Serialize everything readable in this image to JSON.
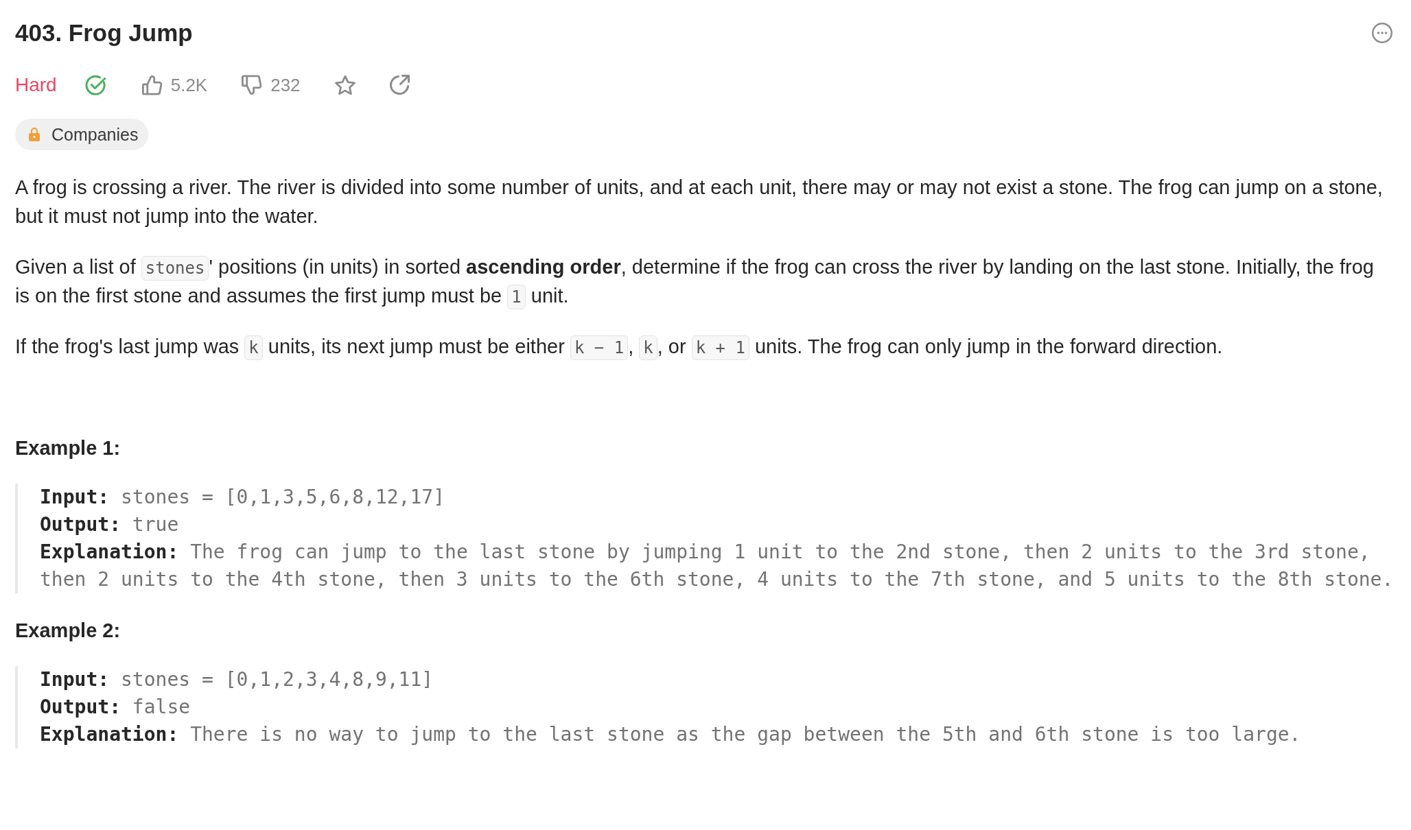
{
  "header": {
    "title": "403. Frog Jump"
  },
  "stats": {
    "difficulty": {
      "label": "Hard",
      "kind": "hard"
    },
    "solved": true,
    "likes": "5.2K",
    "dislikes": "232"
  },
  "companies_tag": {
    "label": "Companies"
  },
  "description": [
    {
      "segments": [
        {
          "kind": "text",
          "text": "A frog is crossing a river. The river is divided into some number of units, and at each unit, there may or may not exist a stone. The frog can jump on a stone, but it must not jump into the water."
        }
      ]
    },
    {
      "segments": [
        {
          "kind": "text",
          "text": "Given a list of "
        },
        {
          "kind": "code",
          "text": "stones"
        },
        {
          "kind": "text",
          "text": "' positions (in units) in sorted **ascending order**, determine if the frog can cross the river by landing on the last stone. Initially, the frog is on the first stone and assumes the first jump must be "
        },
        {
          "kind": "code",
          "text": "1"
        },
        {
          "kind": "text",
          "text": " unit."
        }
      ]
    },
    {
      "segments": [
        {
          "kind": "text",
          "text": "If the frog's last jump was "
        },
        {
          "kind": "code",
          "text": "k"
        },
        {
          "kind": "text",
          "text": " units, its next jump must be either "
        },
        {
          "kind": "code",
          "text": "k − 1"
        },
        {
          "kind": "text",
          "text": ", "
        },
        {
          "kind": "code",
          "text": "k"
        },
        {
          "kind": "text",
          "text": ", or "
        },
        {
          "kind": "code",
          "text": "k + 1"
        },
        {
          "kind": "text",
          "text": " units. The frog can only jump in the forward direction."
        }
      ]
    }
  ],
  "examples": [
    {
      "heading": "Example 1:",
      "lines": [
        "**Input:** stones = [0,1,3,5,6,8,12,17]",
        "**Output:** true",
        "**Explanation:** The frog can jump to the last stone by jumping 1 unit to the 2nd stone, then 2 units to the 3rd stone, then 2 units to the 4th stone, then 3 units to the 6th stone, 4 units to the 7th stone, and 5 units to the 8th stone."
      ]
    },
    {
      "heading": "Example 2:",
      "lines": [
        "**Input:** stones = [0,1,2,3,4,8,9,11]",
        "**Output:** false",
        "**Explanation:** There is no way to jump to the last stone as the gap between the 5th and 6th stone is too large."
      ]
    }
  ]
}
